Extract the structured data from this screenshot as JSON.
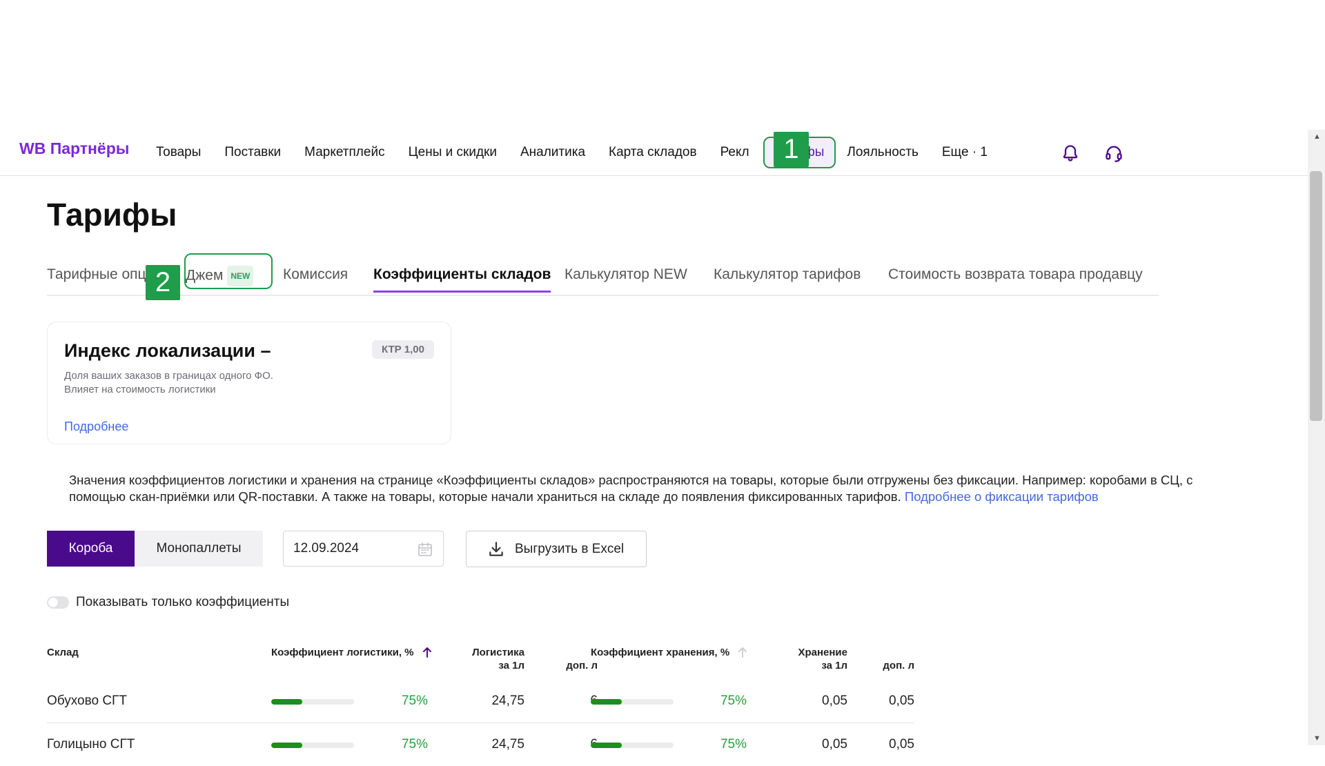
{
  "header": {
    "logo": "WB Партнёры",
    "nav": [
      "Товары",
      "Поставки",
      "Маркетплейс",
      "Цены и скидки",
      "Аналитика",
      "Карта складов",
      "Рекл",
      "Тарифы",
      "Лояльность",
      "Еще · 1"
    ],
    "marker1": "1",
    "marker2": "2"
  },
  "page": {
    "title": "Тарифы",
    "tabs": [
      {
        "label": "Тарифные опц"
      },
      {
        "label": "Джем",
        "badge": "NEW"
      },
      {
        "label": "Комиссия"
      },
      {
        "label": "Коэффициенты складов"
      },
      {
        "label": "Калькулятор NEW"
      },
      {
        "label": "Калькулятор тарифов"
      },
      {
        "label": "Стоимость возврата товара продавцу"
      }
    ]
  },
  "card": {
    "title": "Индекс локализации –",
    "badge": "КТР 1,00",
    "desc1": "Доля ваших заказов в границах одного ФО.",
    "desc2": "Влияет на стоимость логистики",
    "link": "Подробнее"
  },
  "notice": {
    "text": "Значения коэффициентов логистики и хранения на странице «Коэффициенты складов» распространяются на товары, которые были отгружены без фиксации. Например: коробами в СЦ, с помощью скан-приёмки или QR-поставки. А также на товары, которые начали храниться на складе до появления фиксированных тарифов.",
    "link": "Подробнее о фиксации тарифов"
  },
  "controls": {
    "seg_on": "Короба",
    "seg_off": "Монопаллеты",
    "date": "12.09.2024",
    "export": "Выгрузить в Excel",
    "toggle_label": "Показывать только коэффициенты",
    "toggle_on": false
  },
  "table": {
    "headers": {
      "warehouse": "Склад",
      "log_coef": "Коэффициент логистики, %",
      "log_1l_a": "Логистика",
      "log_1l_b": "за 1л",
      "log_add": "доп. л",
      "store_coef": "Коэффициент хранения, %",
      "store_1l_a": "Хранение",
      "store_1l_b": "за 1л",
      "store_add": "доп. л"
    },
    "rows": [
      {
        "name": "Обухово СГТ",
        "log_pct": "75%",
        "log_fill": 0.375,
        "log_1l": "24,75",
        "log_add": "6",
        "store_pct": "75%",
        "store_fill": 0.375,
        "store_1l": "0,05",
        "store_add": "0,05"
      },
      {
        "name": "Голицыно СГТ",
        "log_pct": "75%",
        "log_fill": 0.375,
        "log_1l": "24,75",
        "log_add": "6",
        "store_pct": "75%",
        "store_fill": 0.375,
        "store_1l": "0,05",
        "store_add": "0,05"
      }
    ]
  },
  "colors": {
    "brand": "#7b28d6",
    "primary_button": "#4a0a8c",
    "link": "#4368e0",
    "positive": "#23a23a",
    "marker": "#1f9d4a"
  }
}
